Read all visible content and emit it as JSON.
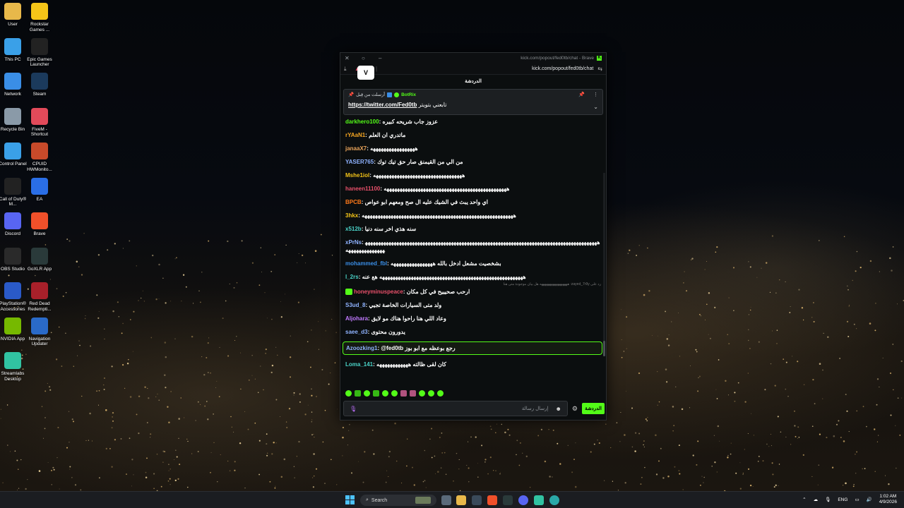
{
  "desktop": {
    "icons": [
      {
        "label": "User",
        "icon": "folder-icon",
        "color": "#e8b84a"
      },
      {
        "label": "Rockstar Games ...",
        "icon": "rockstar-icon",
        "color": "#f5c518"
      },
      {
        "label": "This PC",
        "icon": "monitor-icon",
        "color": "#3aa0e8"
      },
      {
        "label": "Epic Games Launcher",
        "icon": "epic-icon",
        "color": "#222222"
      },
      {
        "label": "Network",
        "icon": "network-icon",
        "color": "#3a8ee6"
      },
      {
        "label": "Steam",
        "icon": "steam-icon",
        "color": "#1b3a5c"
      },
      {
        "label": "Recycle Bin",
        "icon": "recycle-bin-icon",
        "color": "#8a9aa8"
      },
      {
        "label": "FiveM - Shortcut",
        "icon": "fivem-icon",
        "color": "#e24a5a"
      },
      {
        "label": "Control Panel",
        "icon": "control-panel-icon",
        "color": "#3aa0e8"
      },
      {
        "label": "CPUID HWMonito...",
        "icon": "hwmonitor-icon",
        "color": "#c84a2a"
      },
      {
        "label": "Call of Duty® M...",
        "icon": "cod-icon",
        "color": "#222222"
      },
      {
        "label": "EA",
        "icon": "ea-icon",
        "color": "#2a6ee6"
      },
      {
        "label": "Discord",
        "icon": "discord-icon",
        "color": "#5865f2"
      },
      {
        "label": "Brave",
        "icon": "brave-icon",
        "color": "#f0502a"
      },
      {
        "label": "OBS Studio",
        "icon": "obs-icon",
        "color": "#2a2a2a"
      },
      {
        "label": "GoXLR App",
        "icon": "goxlr-icon",
        "color": "#2a3a3a"
      },
      {
        "label": "PlayStation® Accessories",
        "icon": "playstation-icon",
        "color": "#2a5ac8"
      },
      {
        "label": "Red Dead Redempti...",
        "icon": "rdr-icon",
        "color": "#a8202a"
      },
      {
        "label": "NVIDIA App",
        "icon": "nvidia-icon",
        "color": "#76b900"
      },
      {
        "label": "Navigation Updater",
        "icon": "navigation-icon",
        "color": "#2a6ac8"
      },
      {
        "label": "Streamlabs Desktop",
        "icon": "streamlabs-icon",
        "color": "#31c3a2"
      }
    ]
  },
  "browser": {
    "title": "kick.com/popout/fed0tb/chat - Brave",
    "url": "kick.com/popout/fed0tb/chat"
  },
  "chat": {
    "header": "الدردشة",
    "channel_avatar": "V",
    "pinned": {
      "author": "BotRix",
      "label": "أرسلت من قِبل",
      "text": "تابعني بتويتر",
      "link": "https://twitter.com/Fed0tb"
    },
    "messages": [
      {
        "user": "darkhero100",
        "color": "#53fc18",
        "text": "عزوز جاب شريحه كبيره"
      },
      {
        "user": "rYAaN1",
        "color": "#f5a623",
        "text": "ماتدري ان العلم"
      },
      {
        "user": "janaaX7",
        "color": "#e8a35a",
        "text": "هههههههههههههههههه"
      },
      {
        "user": "YASER765",
        "color": "#8fb3ff",
        "text": "من الي من القيمنق صار حق تيك توك"
      },
      {
        "user": "Mshe1iol",
        "color": "#f5c518",
        "text": "ههههههههههههههههههههههههههههههههههه"
      },
      {
        "user": "haneen11100",
        "color": "#e8506a",
        "text": "هههههههههههههههههههههههههههههههههههههههههههههههه"
      },
      {
        "user": "BPCB",
        "color": "#ff7a1a",
        "text": "اي واحد يبث في الشيك عليه ال صح ومعهم ابو عواص"
      },
      {
        "user": "3hkx",
        "color": "#f5c518",
        "text": "ههههههههههههههههههههههههههههههههههههههههههههههههههههههههههه"
      },
      {
        "user": "x512b",
        "color": "#4ad3c8",
        "text": "سنه هذي اخر سنه دنيا"
      },
      {
        "user": "xPrNs",
        "color": "#8fb3ff",
        "text": "ههههههههههههههههههههههههههههههههههههههههههههههههههههههههههههههههههههههههههههههههههههههههههههههههههههههههه"
      },
      {
        "user": "mohammed_fbl",
        "color": "#3a8ee6",
        "text": "بشخصيت مشعل ادخل بالله ههههههههههههههههه"
      },
      {
        "user": "l_2rs",
        "color": "#4ad3c8",
        "text": "هههههههههههههههههههههههههههههههههههههههههههههههههههههههه هع عنه"
      },
      {
        "user": "honeyminuspeace",
        "color": "#e8506a",
        "text": "ارحب صحيييح في كل مكان",
        "reply": "رد على zayed_7r9y: هههههههههههههههههه هل بيان موجودة متى هنا"
      },
      {
        "user": "S3ud_8",
        "color": "#8fb3ff",
        "text": "ولد متى السيارات الخاصة تجيي"
      },
      {
        "user": "Aljohara",
        "color": "#c07aff",
        "text": "وعاد اللي هنا راحوا هناك مو لايق"
      },
      {
        "user": "saee_d3",
        "color": "#8fb3ff",
        "text": "يدورون محتوى"
      },
      {
        "user": "Azoozking1",
        "color": "#8fb3ff",
        "text": "@fed0tb رجع بوعظه مع ابو بوز",
        "highlight": true
      },
      {
        "user": "Loma_141",
        "color": "#4ad3c8",
        "text": "كان لقى ظالته ههههههههههههه"
      }
    ],
    "input_placeholder": "إرسال رسالة",
    "send_label": "الدردشة"
  },
  "taskbar": {
    "search_label": "Search",
    "lang": "ENG",
    "time": "1:02 AM",
    "date": "4/9/2026"
  }
}
